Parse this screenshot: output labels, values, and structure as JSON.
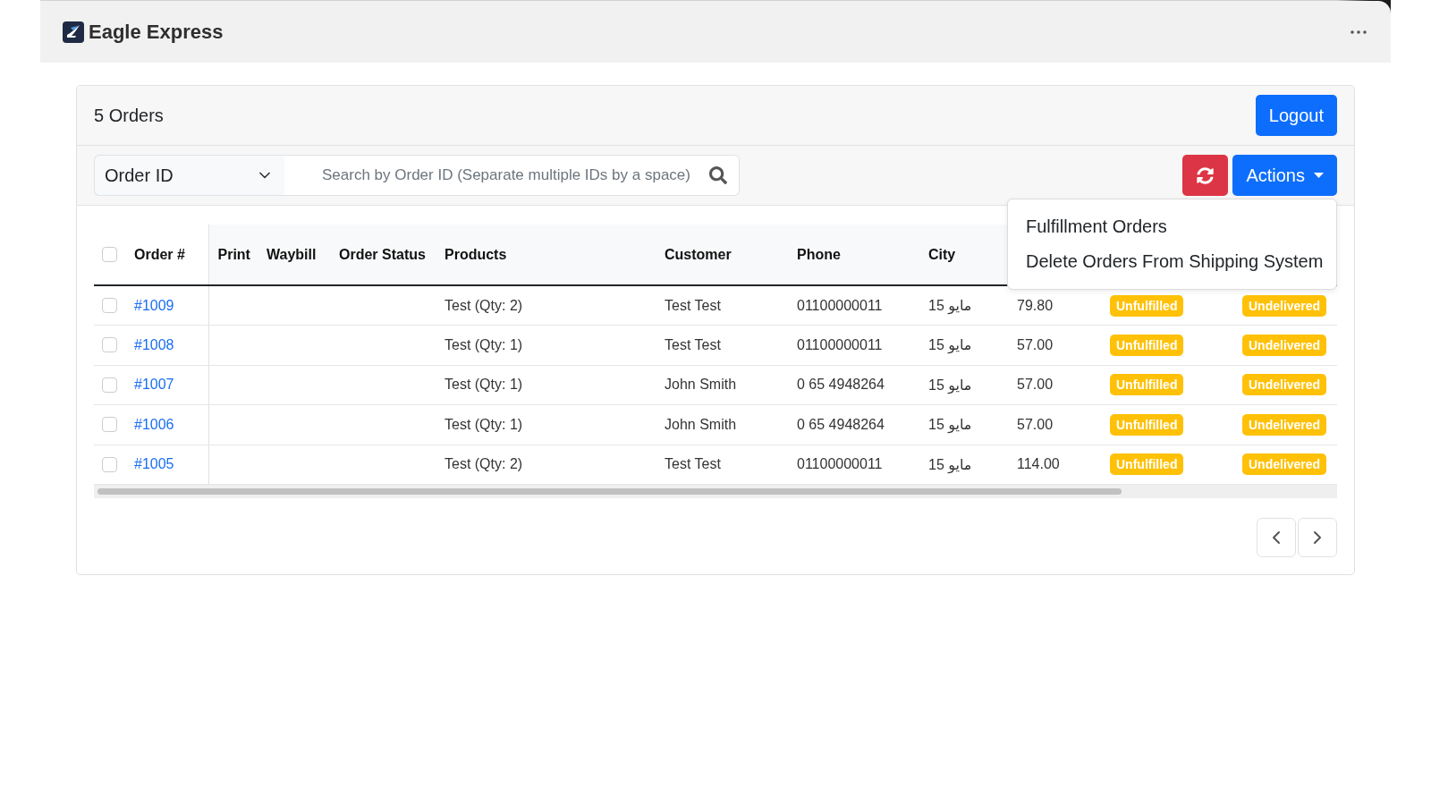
{
  "app_bar": {
    "title": "Eagle Express"
  },
  "orders": {
    "title": "5 Orders",
    "logout": "Logout",
    "filter": {
      "field": "Order ID",
      "search": {
        "placeholder": "Search by Order ID (Separate multiple IDs by a space)"
      }
    },
    "actions": {
      "label": "Actions",
      "expanded": true,
      "menu": [
        "Fulfillment Orders",
        "Delete Orders From Shipping System"
      ]
    },
    "table": {
      "select_all_checked": false,
      "columns": [
        "Order #",
        "Print",
        "Waybill",
        "Order Status",
        "Products",
        "Customer",
        "Phone",
        "City"
      ],
      "rows": [
        {
          "checked": false,
          "order": "#1009",
          "products": "Test (Qty: 2)",
          "customer": "Test Test",
          "phone": "01100000011",
          "city": "15 مايو",
          "total": "79.80",
          "fulfillment": "Unfulfilled",
          "delivery": "Undelivered"
        },
        {
          "checked": false,
          "order": "#1008",
          "products": "Test (Qty: 1)",
          "customer": "Test Test",
          "phone": "01100000011",
          "city": "15 مايو",
          "total": "57.00",
          "fulfillment": "Unfulfilled",
          "delivery": "Undelivered"
        },
        {
          "checked": false,
          "order": "#1007",
          "products": "Test (Qty: 1)",
          "customer": "John Smith",
          "phone": "0 65 4948264",
          "city": "15 مايو",
          "total": "57.00",
          "fulfillment": "Unfulfilled",
          "delivery": "Undelivered"
        },
        {
          "checked": false,
          "order": "#1006",
          "products": "Test (Qty: 1)",
          "customer": "John Smith",
          "phone": "0 65 4948264",
          "city": "15 مايو",
          "total": "57.00",
          "fulfillment": "Unfulfilled",
          "delivery": "Undelivered"
        },
        {
          "checked": false,
          "order": "#1005",
          "products": "Test (Qty: 2)",
          "customer": "Test Test",
          "phone": "01100000011",
          "city": "15 مايو",
          "total": "114.00",
          "fulfillment": "Unfulfilled",
          "delivery": "Undelivered"
        }
      ]
    }
  }
}
